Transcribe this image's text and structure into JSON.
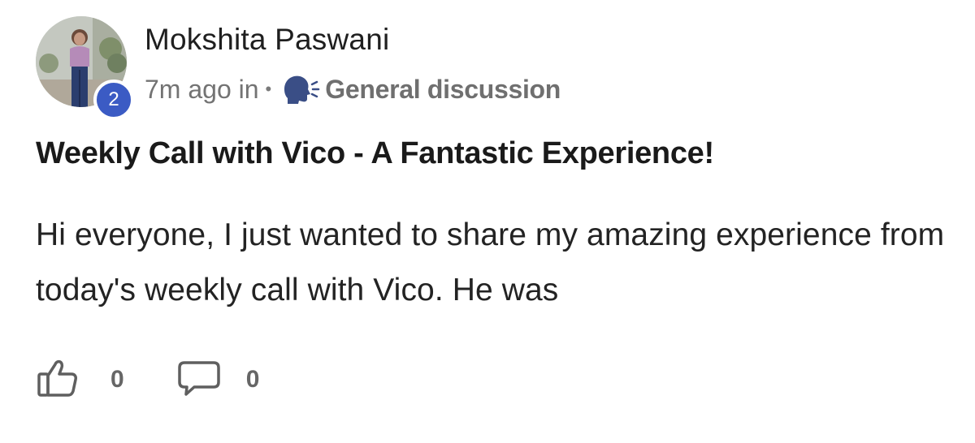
{
  "post": {
    "author": {
      "name": "Mokshita Paswani",
      "level": "2"
    },
    "meta": {
      "time": "7m ago in",
      "separator": "•",
      "space_icon": "speaking-head-icon",
      "space_name": "General discussion"
    },
    "title": "Weekly Call with Vico - A Fantastic Experience!",
    "body": "Hi everyone, I just wanted to share my amazing experience from today's weekly call with Vico. He was",
    "actions": {
      "likes": {
        "icon": "thumbs-up-icon",
        "count": "0"
      },
      "comments": {
        "icon": "comment-bubble-icon",
        "count": "0"
      }
    }
  },
  "colors": {
    "badge": "#3b5bc4",
    "space_icon": "#3a4e86",
    "icon_gray": "#5f5f5f"
  }
}
